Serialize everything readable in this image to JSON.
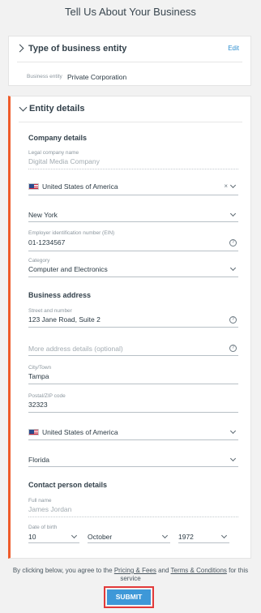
{
  "page": {
    "title": "Tell Us About Your Business"
  },
  "type_section": {
    "title": "Type of business entity",
    "edit_label": "Edit",
    "entity_label": "Business entity",
    "entity_value": "Private Corporation"
  },
  "entity_section": {
    "title": "Entity details",
    "company": {
      "heading": "Company details",
      "legal_name": {
        "label": "Legal company name",
        "value": "Digital Media Company"
      },
      "country": {
        "value": "United States of America",
        "clear": "×"
      },
      "state": {
        "value": "New York"
      },
      "ein": {
        "label": "Employer identification number (EIN)",
        "value": "01-1234567"
      },
      "category": {
        "label": "Category",
        "value": "Computer and Electronics"
      }
    },
    "address": {
      "heading": "Business address",
      "street": {
        "label": "Street and number",
        "value": "123 Jane Road, Suite 2"
      },
      "more": {
        "placeholder": "More address details (optional)"
      },
      "city": {
        "label": "City/Town",
        "value": "Tampa"
      },
      "zip": {
        "label": "Postal/ZIP code",
        "value": "32323"
      },
      "country": {
        "value": "United States of America"
      },
      "state": {
        "value": "Florida"
      }
    },
    "contact": {
      "heading": "Contact person details",
      "full_name": {
        "label": "Full name",
        "value": "James Jordan"
      },
      "dob": {
        "label": "Date of birth",
        "day": "10",
        "month": "October",
        "year": "1972"
      }
    }
  },
  "footer": {
    "text_before": "By clicking below, you agree to the",
    "pricing_link": "Pricing & Fees",
    "and": "and",
    "terms_link": "Terms & Conditions",
    "text_after": "for this service",
    "submit_label": "SUBMIT"
  },
  "icons": {
    "help": "?"
  },
  "colors": {
    "accent_left_border": "#ef5b2a",
    "link": "#2f8fd0",
    "submit_bg": "#3e98d8",
    "submit_highlight": "#e23a3a"
  }
}
